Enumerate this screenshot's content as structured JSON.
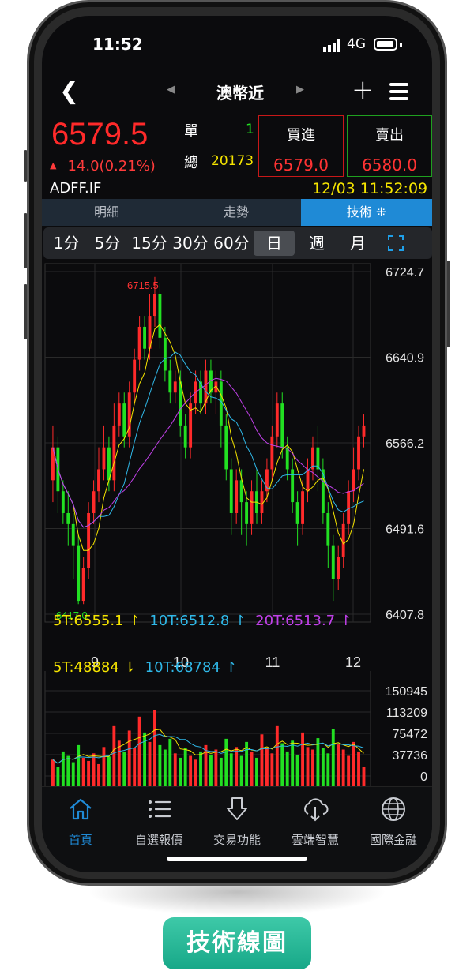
{
  "status_bar": {
    "time": "11:52",
    "network": "4G"
  },
  "navbar": {
    "title": "澳幣近",
    "back_icon": "chevron-left-icon",
    "add_icon": "plus-icon",
    "menu_icon": "hamburger-icon"
  },
  "quote": {
    "last_price": "6579.5",
    "change": "14.0(0.21%)",
    "single_label": "單",
    "single_value": "1",
    "total_label": "總",
    "total_value": "20173",
    "buy_label": "買進",
    "buy_price": "6579.0",
    "sell_label": "賣出",
    "sell_price": "6580.0",
    "symbol": "ADFF.IF",
    "datetime": "12/03 11:52:09",
    "up_color": "#ff2a2a",
    "down_color": "#22e022"
  },
  "tabs": [
    {
      "label": "明細",
      "active": false
    },
    {
      "label": "走勢",
      "active": false
    },
    {
      "label": "技術 ⁜",
      "active": true
    }
  ],
  "periods": [
    {
      "label": "1分",
      "active": false
    },
    {
      "label": "5分",
      "active": false
    },
    {
      "label": "15分",
      "active": false
    },
    {
      "label": "30分",
      "active": false
    },
    {
      "label": "60分",
      "active": false
    },
    {
      "label": "日",
      "active": true
    },
    {
      "label": "週",
      "active": false
    },
    {
      "label": "月",
      "active": false
    }
  ],
  "chart_data": [
    {
      "type": "candlestick",
      "y_ticks": [
        "6724.7",
        "6640.9",
        "6566.2",
        "6491.6",
        "6407.8"
      ],
      "ylim": [
        6407.8,
        6724.7
      ],
      "x_ticks": [
        "9",
        "10",
        "11",
        "12"
      ],
      "high_label": "6715.5",
      "low_label": "6417.0",
      "ma_legend": [
        {
          "label": "5T:6555.1",
          "color": "#f5e400"
        },
        {
          "label": "10T:6512.8",
          "color": "#2fb8e8"
        },
        {
          "label": "20T:6513.7",
          "color": "#c040e8"
        }
      ],
      "candles": [
        [
          6530,
          6560,
          6510,
          6580
        ],
        [
          6560,
          6520,
          6500,
          6570
        ],
        [
          6520,
          6500,
          6490,
          6530
        ],
        [
          6500,
          6490,
          6470,
          6520
        ],
        [
          6490,
          6470,
          6440,
          6500
        ],
        [
          6470,
          6420,
          6417,
          6480
        ],
        [
          6420,
          6450,
          6417,
          6460
        ],
        [
          6450,
          6500,
          6440,
          6510
        ],
        [
          6500,
          6520,
          6490,
          6530
        ],
        [
          6520,
          6540,
          6510,
          6560
        ],
        [
          6540,
          6560,
          6530,
          6580
        ],
        [
          6560,
          6530,
          6520,
          6570
        ],
        [
          6530,
          6580,
          6520,
          6600
        ],
        [
          6580,
          6600,
          6570,
          6610
        ],
        [
          6600,
          6570,
          6560,
          6610
        ],
        [
          6570,
          6610,
          6560,
          6620
        ],
        [
          6610,
          6640,
          6600,
          6650
        ],
        [
          6640,
          6670,
          6630,
          6680
        ],
        [
          6670,
          6650,
          6640,
          6680
        ],
        [
          6650,
          6680,
          6640,
          6700
        ],
        [
          6680,
          6700,
          6670,
          6715.5
        ],
        [
          6700,
          6660,
          6650,
          6710
        ],
        [
          6660,
          6630,
          6620,
          6670
        ],
        [
          6630,
          6610,
          6600,
          6640
        ],
        [
          6610,
          6620,
          6600,
          6630
        ],
        [
          6620,
          6580,
          6570,
          6630
        ],
        [
          6580,
          6560,
          6550,
          6590
        ],
        [
          6560,
          6600,
          6550,
          6610
        ],
        [
          6600,
          6620,
          6590,
          6630
        ],
        [
          6620,
          6600,
          6590,
          6630
        ],
        [
          6600,
          6630,
          6590,
          6640
        ],
        [
          6630,
          6610,
          6600,
          6640
        ],
        [
          6610,
          6620,
          6590,
          6630
        ],
        [
          6620,
          6580,
          6560,
          6630
        ],
        [
          6580,
          6540,
          6530,
          6590
        ],
        [
          6540,
          6500,
          6480,
          6550
        ],
        [
          6500,
          6530,
          6490,
          6540
        ],
        [
          6530,
          6510,
          6480,
          6540
        ],
        [
          6510,
          6490,
          6470,
          6520
        ],
        [
          6490,
          6520,
          6480,
          6530
        ],
        [
          6520,
          6500,
          6490,
          6540
        ],
        [
          6500,
          6520,
          6490,
          6530
        ],
        [
          6520,
          6540,
          6510,
          6550
        ],
        [
          6540,
          6570,
          6530,
          6580
        ],
        [
          6570,
          6600,
          6560,
          6610
        ],
        [
          6600,
          6560,
          6550,
          6610
        ],
        [
          6560,
          6540,
          6530,
          6570
        ],
        [
          6540,
          6510,
          6500,
          6550
        ],
        [
          6510,
          6490,
          6470,
          6520
        ],
        [
          6490,
          6520,
          6480,
          6530
        ],
        [
          6520,
          6540,
          6510,
          6550
        ],
        [
          6540,
          6560,
          6530,
          6570
        ],
        [
          6560,
          6540,
          6520,
          6580
        ],
        [
          6540,
          6500,
          6490,
          6550
        ],
        [
          6500,
          6470,
          6450,
          6510
        ],
        [
          6470,
          6440,
          6420,
          6480
        ],
        [
          6440,
          6460,
          6430,
          6470
        ],
        [
          6460,
          6490,
          6450,
          6500
        ],
        [
          6490,
          6520,
          6480,
          6530
        ],
        [
          6520,
          6540,
          6510,
          6560
        ],
        [
          6540,
          6570,
          6530,
          6580
        ],
        [
          6570,
          6580,
          6560,
          6590
        ]
      ]
    },
    {
      "type": "bar",
      "y_ticks": [
        "150945",
        "113209",
        "75472",
        "37736",
        "0"
      ],
      "ylim": [
        0,
        150945
      ],
      "ma_legend": [
        {
          "label": "5T:48884",
          "color": "#f5e400"
        },
        {
          "label": "10T:68784",
          "color": "#2fb8e8"
        }
      ],
      "volumes": [
        42000,
        30000,
        55000,
        48000,
        38000,
        65000,
        45000,
        40000,
        52000,
        35000,
        62000,
        47000,
        95000,
        72000,
        55000,
        88000,
        60000,
        110000,
        85000,
        70000,
        120000,
        65000,
        58000,
        75000,
        52000,
        45000,
        60000,
        48000,
        42000,
        55000,
        65000,
        50000,
        58000,
        45000,
        75000,
        52000,
        62000,
        48000,
        70000,
        55000,
        45000,
        82000,
        60000,
        52000,
        95000,
        68000,
        55000,
        72000,
        50000,
        85000,
        62000,
        58000,
        76000,
        60000,
        52000,
        90000,
        66000,
        58000,
        48000,
        70000,
        55000,
        30000
      ]
    }
  ],
  "bottom_nav": [
    {
      "label": "首頁",
      "icon": "home-icon",
      "active": true
    },
    {
      "label": "自選報價",
      "icon": "star-list-icon",
      "active": false
    },
    {
      "label": "交易功能",
      "icon": "trade-arrow-icon",
      "active": false
    },
    {
      "label": "雲端智慧",
      "icon": "cloud-download-icon",
      "active": false
    },
    {
      "label": "國際金融",
      "icon": "globe-icon",
      "active": false
    }
  ],
  "caption": "技術線圖"
}
